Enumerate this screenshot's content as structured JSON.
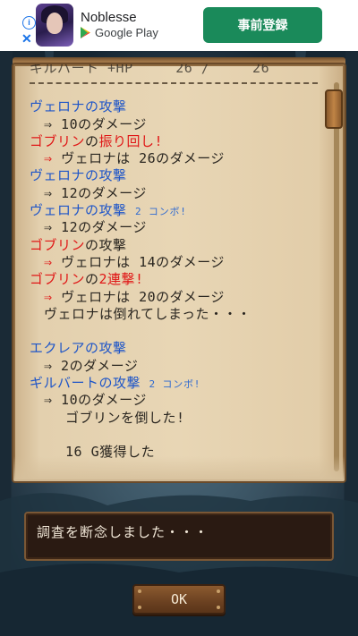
{
  "ad": {
    "app_name": "Noblesse",
    "store": "Google Play",
    "cta": "事前登録",
    "info_icon": "info-icon",
    "close_icon": "close-icon"
  },
  "log": {
    "header_partial": "ギルバート +HP     26 /     26",
    "lines": [
      {
        "parts": [
          {
            "t": "ヴェロナの攻撃",
            "c": "blue"
          }
        ]
      },
      {
        "indent": 1,
        "parts": [
          {
            "t": "⇒ 10のダメージ",
            "c": "dark"
          }
        ]
      },
      {
        "parts": [
          {
            "t": "ゴブリン",
            "c": "red"
          },
          {
            "t": "の",
            "c": "dark"
          },
          {
            "t": "振り回し!",
            "c": "red"
          }
        ]
      },
      {
        "indent": 1,
        "parts": [
          {
            "t": "⇒ ",
            "c": "red"
          },
          {
            "t": "ヴェロナは 26のダメージ",
            "c": "dark"
          }
        ]
      },
      {
        "parts": [
          {
            "t": "ヴェロナの攻撃",
            "c": "blue"
          }
        ]
      },
      {
        "indent": 1,
        "parts": [
          {
            "t": "⇒ 12のダメージ",
            "c": "dark"
          }
        ]
      },
      {
        "parts": [
          {
            "t": "ヴェロナの攻撃 ",
            "c": "blue"
          },
          {
            "t": "2 コンボ!",
            "c": "small"
          }
        ]
      },
      {
        "indent": 1,
        "parts": [
          {
            "t": "⇒ 12のダメージ",
            "c": "dark"
          }
        ]
      },
      {
        "parts": [
          {
            "t": "ゴブリン",
            "c": "red"
          },
          {
            "t": "の攻撃",
            "c": "dark"
          }
        ]
      },
      {
        "indent": 1,
        "parts": [
          {
            "t": "⇒ ",
            "c": "red"
          },
          {
            "t": "ヴェロナは 14のダメージ",
            "c": "dark"
          }
        ]
      },
      {
        "parts": [
          {
            "t": "ゴブリン",
            "c": "red"
          },
          {
            "t": "の",
            "c": "dark"
          },
          {
            "t": "2連撃!",
            "c": "red"
          }
        ]
      },
      {
        "indent": 1,
        "parts": [
          {
            "t": "⇒ ",
            "c": "red"
          },
          {
            "t": "ヴェロナは 20のダメージ",
            "c": "dark"
          }
        ]
      },
      {
        "indent": 1,
        "parts": [
          {
            "t": "ヴェロナは倒れてしまった・・・",
            "c": "dark"
          }
        ]
      },
      {
        "parts": [
          {
            "t": " ",
            "c": "dark"
          }
        ]
      },
      {
        "parts": [
          {
            "t": "エクレアの攻撃",
            "c": "blue"
          }
        ]
      },
      {
        "indent": 1,
        "parts": [
          {
            "t": "⇒ 2のダメージ",
            "c": "dark"
          }
        ]
      },
      {
        "parts": [
          {
            "t": "ギルバートの攻撃 ",
            "c": "blue"
          },
          {
            "t": "2 コンボ!",
            "c": "small"
          }
        ]
      },
      {
        "indent": 1,
        "parts": [
          {
            "t": "⇒ 10のダメージ",
            "c": "dark"
          }
        ]
      },
      {
        "indent": 2,
        "parts": [
          {
            "t": "ゴブリンを倒した!",
            "c": "dark"
          }
        ]
      },
      {
        "parts": [
          {
            "t": " ",
            "c": "dark"
          }
        ]
      },
      {
        "indent": 2,
        "parts": [
          {
            "t": "16 G獲得した",
            "c": "dark"
          }
        ]
      }
    ]
  },
  "message": "調査を断念しました・・・",
  "ok_label": "OK"
}
